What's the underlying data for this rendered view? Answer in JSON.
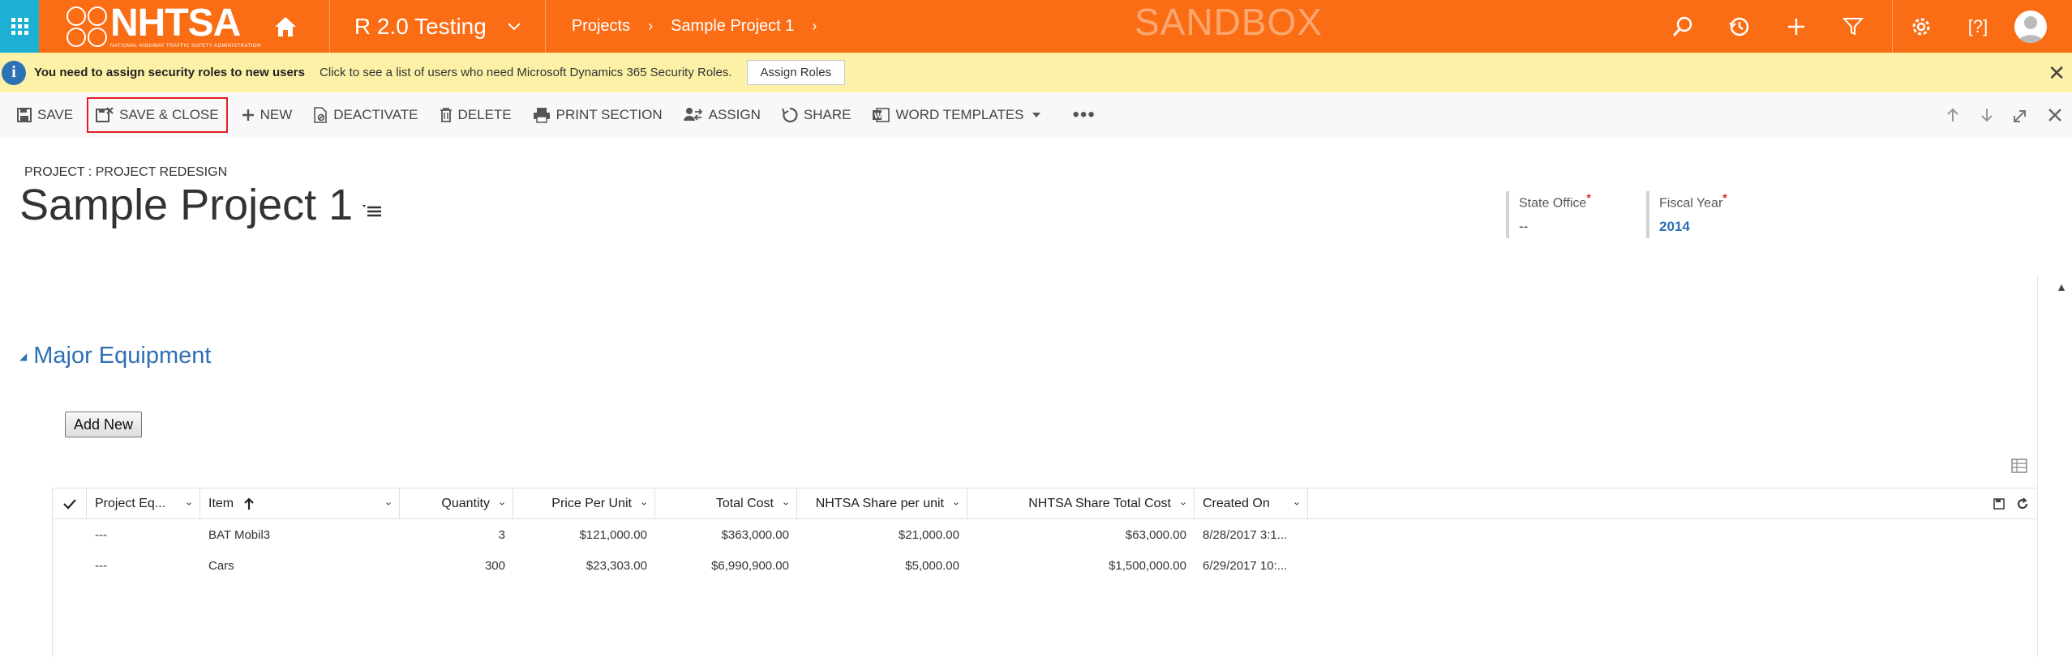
{
  "nav": {
    "logo_text": "NHTSA",
    "logo_subtitle": "NATIONAL HIGHWAY TRAFFIC SAFETY ADMINISTRATION",
    "app_name": "R 2.0 Testing",
    "breadcrumb": [
      "Projects",
      "Sample Project 1"
    ],
    "environment": "SANDBOX",
    "icons": [
      "search-icon",
      "history-icon",
      "plus-icon",
      "filter-icon",
      "gear-icon",
      "help-icon",
      "user-avatar"
    ]
  },
  "notification": {
    "title": "You need to assign security roles to new users",
    "message": "Click to see a list of users who need Microsoft Dynamics 365 Security Roles.",
    "button": "Assign Roles"
  },
  "commands": {
    "save": "SAVE",
    "save_close": "SAVE & CLOSE",
    "new": "NEW",
    "deactivate": "DEACTIVATE",
    "delete": "DELETE",
    "print_section": "PRINT SECTION",
    "assign": "ASSIGN",
    "share": "SHARE",
    "word_templates": "WORD TEMPLATES",
    "more": "•••"
  },
  "header": {
    "entity": "PROJECT : PROJECT REDESIGN",
    "title": "Sample Project 1",
    "state_office_label": "State Office",
    "state_office_value": "--",
    "fiscal_year_label": "Fiscal Year",
    "fiscal_year_value": "2014"
  },
  "section": {
    "title": "Major Equipment",
    "add_button": "Add New"
  },
  "grid": {
    "columns": [
      "Project Eq...",
      "Item",
      "Quantity",
      "Price Per Unit",
      "Total Cost",
      "NHTSA Share per unit",
      "NHTSA Share Total Cost",
      "Created On"
    ],
    "rows": [
      [
        "---",
        "BAT Mobil3",
        "3",
        "$121,000.00",
        "$363,000.00",
        "$21,000.00",
        "$63,000.00",
        "8/28/2017 3:1..."
      ],
      [
        "---",
        "Cars",
        "300",
        "$23,303.00",
        "$6,990,900.00",
        "$5,000.00",
        "$1,500,000.00",
        "6/29/2017 10:..."
      ]
    ]
  },
  "colors": {
    "nav_bg": "#fa6d14",
    "waffle_bg": "#1cb0d4",
    "notification_bg": "#fdf1a8",
    "link_blue": "#2f6fb5",
    "highlight_red": "#e21f26"
  }
}
